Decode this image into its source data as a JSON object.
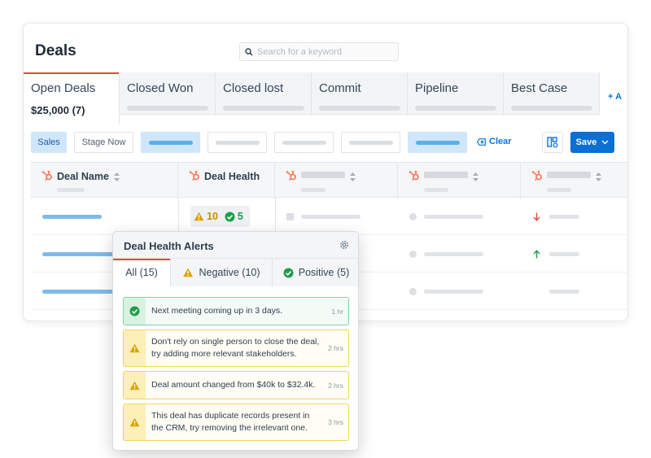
{
  "page": {
    "title": "Deals"
  },
  "search": {
    "placeholder": "Search for a keyword"
  },
  "tabs": [
    {
      "label": "Open Deals",
      "value": "$25,000 (7)",
      "active": true
    },
    {
      "label": "Closed Won"
    },
    {
      "label": "Closed lost"
    },
    {
      "label": "Commit"
    },
    {
      "label": "Pipeline"
    },
    {
      "label": "Best Case"
    }
  ],
  "add_tab_label": "+ A",
  "filters": {
    "sales_label": "Sales",
    "stage_label": "Stage Now",
    "clear_label": "Clear",
    "save_label": "Save"
  },
  "table": {
    "columns": [
      "Deal Name",
      "Deal Health"
    ],
    "health": {
      "negative": "10",
      "positive": "5"
    }
  },
  "popup": {
    "title": "Deal Health Alerts",
    "tabs": [
      "All (15)",
      "Negative (10)",
      "Positive (5)"
    ],
    "alerts": [
      {
        "type": "positive",
        "text": "Next meeting coming up in 3 days.",
        "time": "1 hr"
      },
      {
        "type": "negative",
        "text": "Don't rely on single person to close the deal, try adding more relevant stakeholders.",
        "time": "2 hrs"
      },
      {
        "type": "negative",
        "text": "Deal amount changed from $40k to $32.4k.",
        "time": "2 hrs"
      },
      {
        "type": "negative",
        "text": "This deal has duplicate records present in the CRM, try removing the irrelevant one.",
        "time": "3 hrs"
      }
    ]
  },
  "colors": {
    "accent": "#0b6fd3",
    "active_tab_line": "#e8463a",
    "positive": "#1e9e4a",
    "warning": "#d9a200",
    "hubspot": "#ff7a59"
  }
}
